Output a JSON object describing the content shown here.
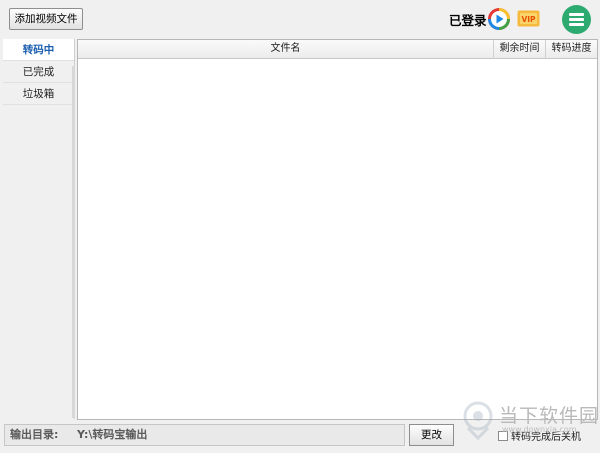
{
  "toolbar": {
    "add_button_label": "添加视频文件",
    "login_status": "已登录",
    "vip_text": "VIP",
    "play_icon": "play-circle-icon",
    "vip_icon": "vip-ticket-icon",
    "menu_icon": "hamburger-menu-icon"
  },
  "sidebar": {
    "items": [
      {
        "label": "转码中",
        "active": true
      },
      {
        "label": "已完成",
        "active": false
      },
      {
        "label": "垃圾箱",
        "active": false
      }
    ]
  },
  "table": {
    "columns": [
      "文件名",
      "剩余时间",
      "转码进度"
    ],
    "rows": []
  },
  "bottom": {
    "output_label": "输出目录:",
    "output_path": "Y:\\转码宝输出",
    "change_button_label": "更改",
    "shutdown_label": "转码完成后关机",
    "shutdown_checked": false
  },
  "watermark": {
    "brand_text": "当下软件园",
    "url_text": "www.downxia.com"
  },
  "colors": {
    "accent_green": "#2daa6f",
    "active_tab_text": "#1c5fb0"
  }
}
